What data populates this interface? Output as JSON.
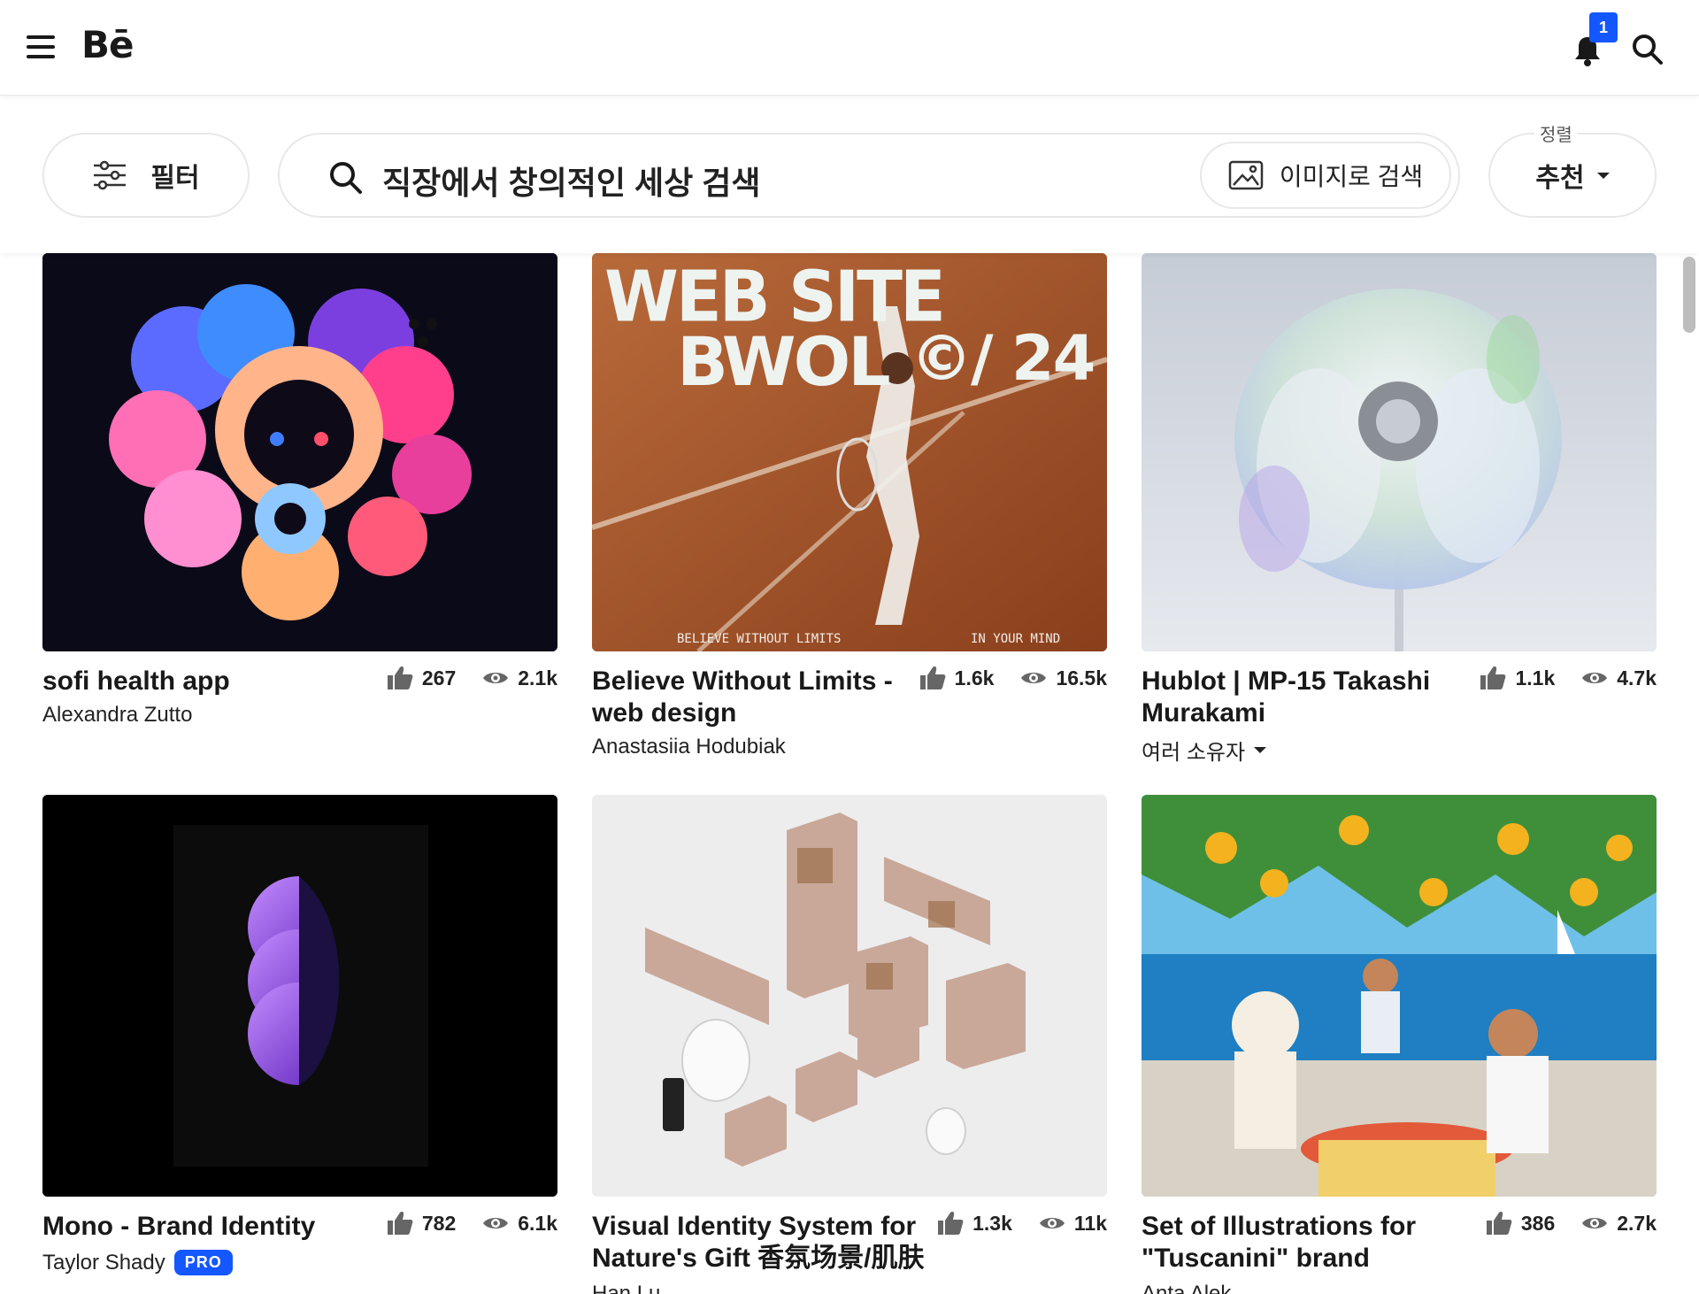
{
  "header": {
    "logo": "Bē",
    "notification_count": "1"
  },
  "filters": {
    "filter_label": "필터",
    "search_placeholder": "직장에서 창의적인 세상 검색",
    "image_search_label": "이미지로 검색",
    "sort_caption": "정렬",
    "sort_value": "추천"
  },
  "projects": [
    {
      "title": "sofi health app",
      "owner": "Alexandra Zutto",
      "likes": "267",
      "views": "2.1k"
    },
    {
      "title": "Believe Without Limits - web design",
      "owner": "Anastasiia Hodubiak",
      "likes": "1.6k",
      "views": "16.5k",
      "artwork": {
        "line1": "WEB SITE",
        "line2": "BWOL",
        "line3": "©/ 24",
        "footer_left": "BELIEVE WITHOUT LIMITS",
        "footer_right": "IN YOUR MIND"
      }
    },
    {
      "title": "Hublot | MP-15 Takashi Murakami",
      "owner": "여러 소유자",
      "likes": "1.1k",
      "views": "4.7k"
    },
    {
      "title": "Mono - Brand Identity",
      "owner": "Taylor Shady",
      "owner_badge": "PRO",
      "likes": "782",
      "views": "6.1k"
    },
    {
      "title": "Visual Identity System for Nature's Gift 香氛场景/肌肤",
      "owner": "Han Lu",
      "likes": "1.3k",
      "views": "11k"
    },
    {
      "title": "Set of Illustrations for \"Tuscanini\" brand",
      "owner": "Anta Alek",
      "likes": "386",
      "views": "2.7k"
    }
  ],
  "colors": {
    "accent": "#1457ff",
    "text": "#191919",
    "border": "#e8e8e8"
  }
}
